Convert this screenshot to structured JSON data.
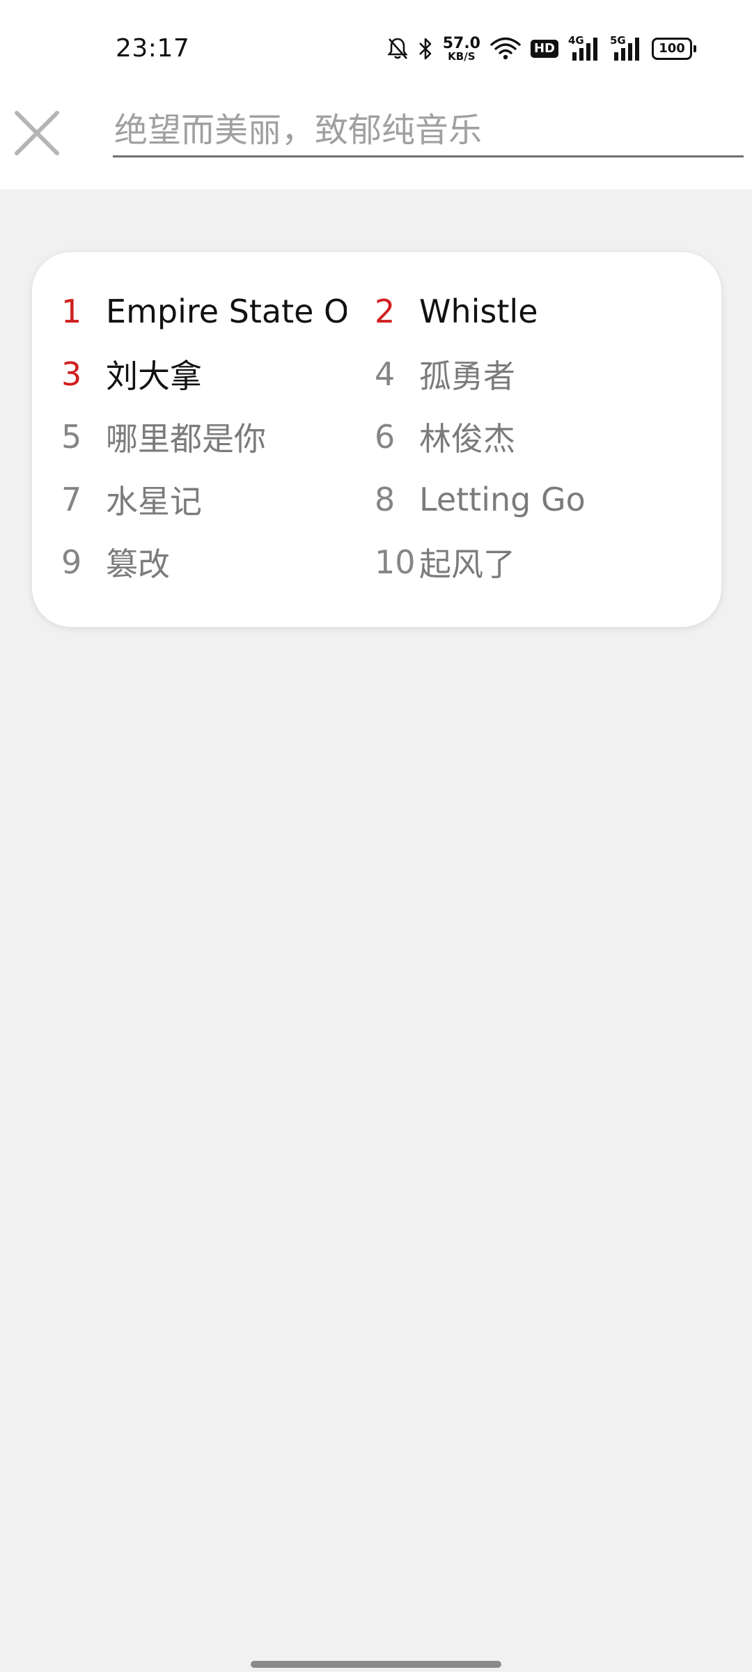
{
  "status_bar": {
    "time": "23:17",
    "net_speed_value": "57.0",
    "net_speed_unit": "KB/S",
    "hd_label": "HD",
    "sim1_label": "4G",
    "sim2_label": "5G",
    "battery": "100"
  },
  "search": {
    "placeholder": "绝望而美丽，致郁纯音乐",
    "value": ""
  },
  "hot_list": {
    "items": [
      {
        "rank": "1",
        "title": "Empire State Of Mind"
      },
      {
        "rank": "2",
        "title": "Whistle"
      },
      {
        "rank": "3",
        "title": "刘大拿"
      },
      {
        "rank": "4",
        "title": "孤勇者"
      },
      {
        "rank": "5",
        "title": "哪里都是你"
      },
      {
        "rank": "6",
        "title": "林俊杰"
      },
      {
        "rank": "7",
        "title": "水星记"
      },
      {
        "rank": "8",
        "title": "Letting Go"
      },
      {
        "rank": "9",
        "title": "篡改"
      },
      {
        "rank": "10",
        "title": "起风了"
      }
    ]
  },
  "colors": {
    "accent_red": "#d0201f",
    "card_bg": "#ffffff",
    "page_bg": "#f1f1f1",
    "muted_text": "#7b7b7b"
  }
}
